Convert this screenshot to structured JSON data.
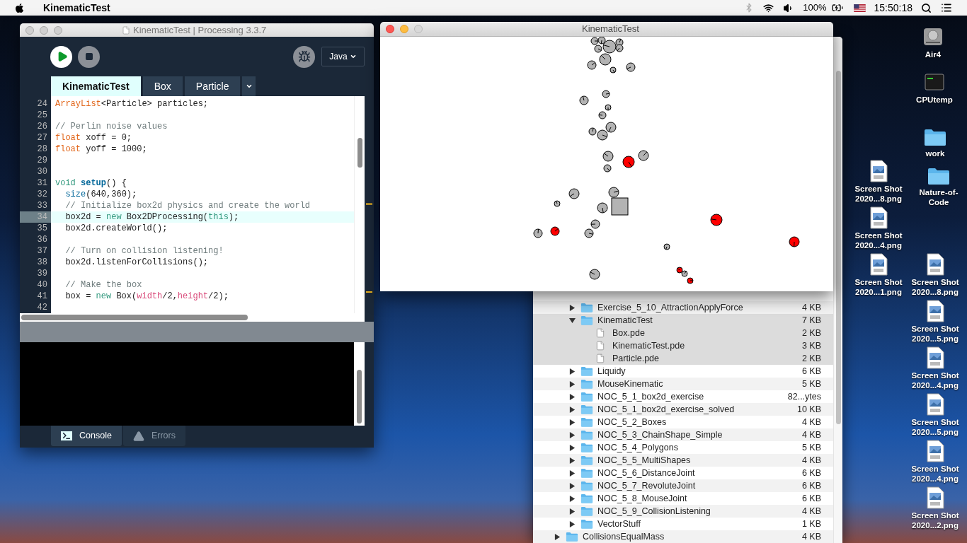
{
  "menu_bar": {
    "app_name": "KinematicTest",
    "battery_percent": "100%",
    "clock": "15:50:18"
  },
  "ide_window": {
    "title": "KinematicTest | Processing 3.3.7",
    "mode": "Java",
    "tabs": [
      {
        "label": "KinematicTest",
        "selected": true
      },
      {
        "label": "Box",
        "selected": false
      },
      {
        "label": "Particle",
        "selected": false
      }
    ],
    "code_lines": [
      {
        "number": "24",
        "current": false,
        "tokens": [
          {
            "kind": "type",
            "text": "ArrayList"
          },
          {
            "kind": "plain",
            "text": "<Particle> particles;"
          }
        ]
      },
      {
        "number": "25",
        "current": false
      },
      {
        "number": "26",
        "current": false,
        "tokens": [
          {
            "kind": "comment",
            "text": "// Perlin noise values"
          }
        ]
      },
      {
        "number": "27",
        "current": false,
        "tokens": [
          {
            "kind": "type",
            "text": "float"
          },
          {
            "kind": "plain",
            "text": " xoff = 0;"
          }
        ]
      },
      {
        "number": "28",
        "current": false,
        "tokens": [
          {
            "kind": "type",
            "text": "float"
          },
          {
            "kind": "plain",
            "text": " yoff = 1000;"
          }
        ]
      },
      {
        "number": "29",
        "current": false
      },
      {
        "number": "30",
        "current": false
      },
      {
        "number": "31",
        "current": false,
        "tokens": [
          {
            "kind": "keyword",
            "text": "void"
          },
          {
            "kind": "function_def",
            "text": " setup"
          },
          {
            "kind": "plain",
            "text": "() {"
          }
        ]
      },
      {
        "number": "32",
        "current": false,
        "tokens": [
          {
            "kind": "function",
            "text": "  size"
          },
          {
            "kind": "plain",
            "text": "(640,360);"
          }
        ]
      },
      {
        "number": "33",
        "current": false,
        "tokens": [
          {
            "kind": "comment",
            "text": "  // Initialize box2d physics and create the world"
          }
        ]
      },
      {
        "number": "34",
        "current": true,
        "tokens": [
          {
            "kind": "plain",
            "text": "  box2d = "
          },
          {
            "kind": "keyword",
            "text": "new"
          },
          {
            "kind": "plain",
            "text": " Box2DProcessing("
          },
          {
            "kind": "keyword",
            "text": "this"
          },
          {
            "kind": "plain",
            "text": ");"
          }
        ]
      },
      {
        "number": "35",
        "current": false,
        "tokens": [
          {
            "kind": "plain",
            "text": "  box2d.createWorld();"
          }
        ]
      },
      {
        "number": "36",
        "current": false
      },
      {
        "number": "37",
        "current": false,
        "tokens": [
          {
            "kind": "comment",
            "text": "  // Turn on collision listening!"
          }
        ]
      },
      {
        "number": "38",
        "current": false,
        "tokens": [
          {
            "kind": "plain",
            "text": "  box2d.listenForCollisions();"
          }
        ]
      },
      {
        "number": "39",
        "current": false
      },
      {
        "number": "40",
        "current": false,
        "tokens": [
          {
            "kind": "comment",
            "text": "  // Make the box"
          }
        ]
      },
      {
        "number": "41",
        "current": false,
        "tokens": [
          {
            "kind": "plain",
            "text": "  box = "
          },
          {
            "kind": "keyword",
            "text": "new"
          },
          {
            "kind": "plain",
            "text": " Box("
          },
          {
            "kind": "constant",
            "text": "width"
          },
          {
            "kind": "plain",
            "text": "/2,"
          },
          {
            "kind": "constant",
            "text": "height"
          },
          {
            "kind": "plain",
            "text": "/2);"
          }
        ]
      },
      {
        "number": "42",
        "current": false
      }
    ],
    "footer_tabs": [
      {
        "label": "Console",
        "kind": "console",
        "selected": true
      },
      {
        "label": "Errors",
        "kind": "errors",
        "selected": false
      }
    ]
  },
  "sketch_window": {
    "title": "KinematicTest"
  },
  "finder": {
    "items": [
      {
        "name": "Exercise_5_10_AttractionApplyForce",
        "size": "4 KB",
        "kind": "folder",
        "expanded": false,
        "selected": false
      },
      {
        "name": "KinematicTest",
        "size": "7 KB",
        "kind": "folder",
        "expanded": true,
        "selected": true,
        "children": [
          {
            "name": "Box.pde",
            "size": "2 KB",
            "kind": "file",
            "selected": false
          },
          {
            "name": "KinematicTest.pde",
            "size": "3 KB",
            "kind": "file",
            "selected": false
          },
          {
            "name": "Particle.pde",
            "size": "2 KB",
            "kind": "file",
            "selected": false
          }
        ]
      },
      {
        "name": "Liquidy",
        "size": "6 KB",
        "kind": "folder",
        "expanded": false,
        "selected": false
      },
      {
        "name": "MouseKinematic",
        "size": "5 KB",
        "kind": "folder",
        "expanded": false,
        "selected": false
      },
      {
        "name": "NOC_5_1_box2d_exercise",
        "size": "82...ytes",
        "kind": "folder",
        "expanded": false,
        "selected": false
      },
      {
        "name": "NOC_5_1_box2d_exercise_solved",
        "size": "10 KB",
        "kind": "folder",
        "expanded": false,
        "selected": false
      },
      {
        "name": "NOC_5_2_Boxes",
        "size": "4 KB",
        "kind": "folder",
        "expanded": false,
        "selected": false
      },
      {
        "name": "NOC_5_3_ChainShape_Simple",
        "size": "4 KB",
        "kind": "folder",
        "expanded": false,
        "selected": false
      },
      {
        "name": "NOC_5_4_Polygons",
        "size": "5 KB",
        "kind": "folder",
        "expanded": false,
        "selected": false
      },
      {
        "name": "NOC_5_5_MultiShapes",
        "size": "4 KB",
        "kind": "folder",
        "expanded": false,
        "selected": false
      },
      {
        "name": "NOC_5_6_DistanceJoint",
        "size": "6 KB",
        "kind": "folder",
        "expanded": false,
        "selected": false
      },
      {
        "name": "NOC_5_7_RevoluteJoint",
        "size": "6 KB",
        "kind": "folder",
        "expanded": false,
        "selected": false
      },
      {
        "name": "NOC_5_8_MouseJoint",
        "size": "6 KB",
        "kind": "folder",
        "expanded": false,
        "selected": false
      },
      {
        "name": "NOC_5_9_CollisionListening",
        "size": "4 KB",
        "kind": "folder",
        "expanded": false,
        "selected": false
      },
      {
        "name": "VectorStuff",
        "size": "1 KB",
        "kind": "folder",
        "expanded": false,
        "selected": false
      }
    ],
    "parent_level_items": [
      {
        "name": "CollisionsEqualMass",
        "size": "4 KB",
        "kind": "folder",
        "expanded": false,
        "selected": false
      }
    ]
  },
  "desktop_icons": [
    {
      "label": "Air4",
      "kind": "drive"
    },
    {
      "label": "CPUtemp",
      "kind": "terminal"
    },
    {
      "label": "work",
      "kind": "folder"
    },
    {
      "label": "Screen Shot 2020...8.png",
      "kind": "image"
    },
    {
      "label": "Nature-of-Code",
      "kind": "folder"
    },
    {
      "label": "Screen Shot 2020...4.png",
      "kind": "image"
    },
    {
      "label": "Screen Shot 2020...1.png",
      "kind": "image"
    },
    {
      "label": "Screen Shot 2020...8.png",
      "kind": "image"
    },
    {
      "label": "Screen Shot 2020...5.png",
      "kind": "image"
    },
    {
      "label": "Screen Shot 2020...4.png",
      "kind": "image"
    },
    {
      "label": "Screen Shot 2020...5.png",
      "kind": "image"
    },
    {
      "label": "Screen Shot 2020...4.png",
      "kind": "image"
    },
    {
      "label": "Screen Shot 2020...2.png",
      "kind": "image"
    }
  ]
}
